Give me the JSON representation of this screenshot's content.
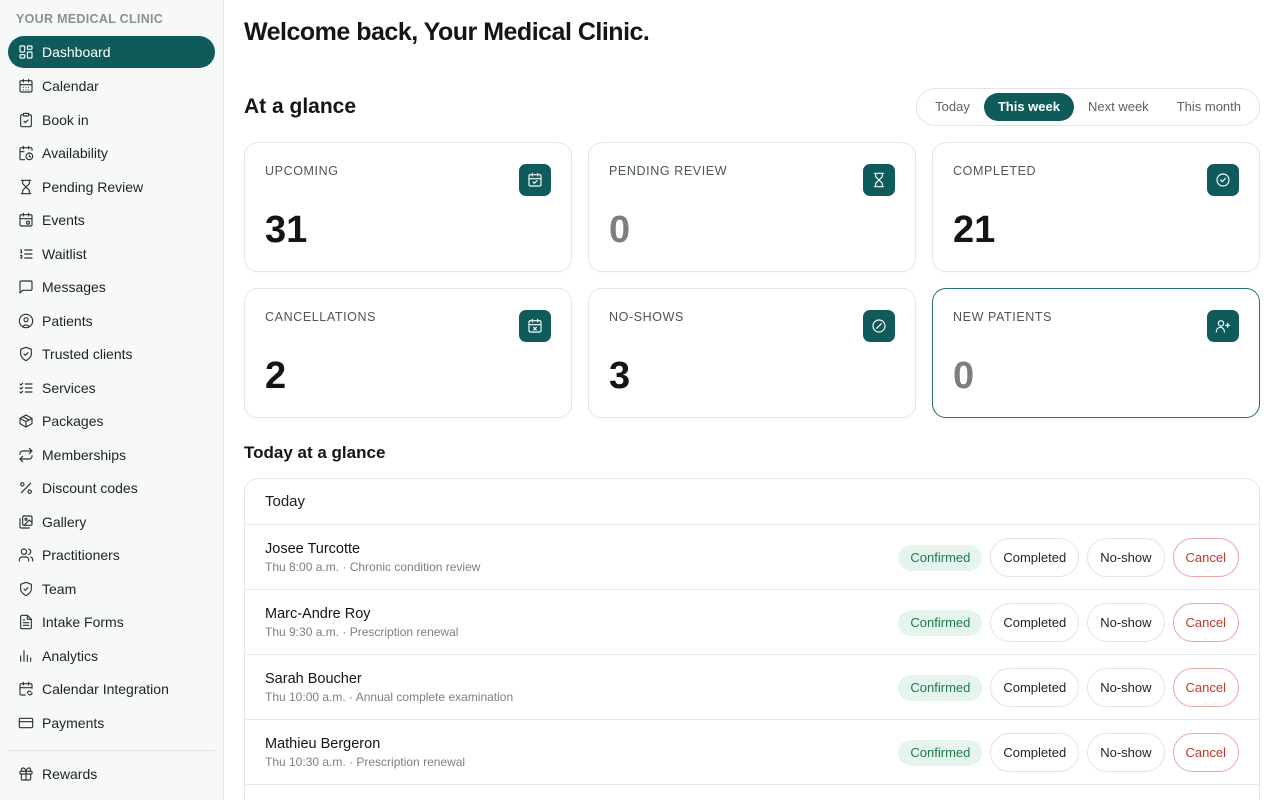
{
  "sidebar": {
    "org_name": "YOUR MEDICAL CLINIC",
    "items": [
      {
        "label": "Dashboard",
        "icon": "grid-icon",
        "active": true
      },
      {
        "label": "Calendar",
        "icon": "calendar-icon"
      },
      {
        "label": "Book in",
        "icon": "clipboard-icon"
      },
      {
        "label": "Availability",
        "icon": "calendar-clock-icon"
      },
      {
        "label": "Pending Review",
        "icon": "hourglass-icon"
      },
      {
        "label": "Events",
        "icon": "calendar-event-icon"
      },
      {
        "label": "Waitlist",
        "icon": "list-ordered-icon"
      },
      {
        "label": "Messages",
        "icon": "message-icon"
      },
      {
        "label": "Patients",
        "icon": "user-circle-icon"
      },
      {
        "label": "Trusted clients",
        "icon": "shield-check-icon"
      },
      {
        "label": "Services",
        "icon": "list-check-icon"
      },
      {
        "label": "Packages",
        "icon": "package-icon"
      },
      {
        "label": "Memberships",
        "icon": "repeat-icon"
      },
      {
        "label": "Discount codes",
        "icon": "percent-icon"
      },
      {
        "label": "Gallery",
        "icon": "images-icon"
      },
      {
        "label": "Practitioners",
        "icon": "users-icon"
      },
      {
        "label": "Team",
        "icon": "shield-icon"
      },
      {
        "label": "Intake Forms",
        "icon": "file-text-icon"
      },
      {
        "label": "Analytics",
        "icon": "bar-chart-icon"
      },
      {
        "label": "Calendar Integration",
        "icon": "calendar-sync-icon"
      },
      {
        "label": "Payments",
        "icon": "credit-card-icon"
      }
    ],
    "footer_items": [
      {
        "label": "Rewards",
        "icon": "gift-icon"
      }
    ]
  },
  "header": {
    "welcome": "Welcome back, Your Medical Clinic."
  },
  "glance": {
    "title": "At a glance",
    "periods": [
      "Today",
      "This week",
      "Next week",
      "This month"
    ],
    "selected_period": "This week",
    "cards": [
      {
        "label": "UPCOMING",
        "value": "31",
        "icon": "calendar-check-icon"
      },
      {
        "label": "PENDING REVIEW",
        "value": "0",
        "icon": "hourglass-icon"
      },
      {
        "label": "COMPLETED",
        "value": "21",
        "icon": "check-circle-icon"
      },
      {
        "label": "CANCELLATIONS",
        "value": "2",
        "icon": "calendar-x-icon"
      },
      {
        "label": "NO-SHOWS",
        "value": "3",
        "icon": "ban-icon"
      },
      {
        "label": "NEW PATIENTS",
        "value": "0",
        "icon": "user-plus-icon"
      }
    ]
  },
  "today": {
    "title": "Today at a glance",
    "table_header": "Today",
    "status_label": "Confirmed",
    "completed_label": "Completed",
    "noshow_label": "No-show",
    "cancel_label": "Cancel",
    "rows": [
      {
        "name": "Josee Turcotte",
        "detail": "Thu 8:00 a.m. · Chronic condition review"
      },
      {
        "name": "Marc-Andre Roy",
        "detail": "Thu 9:30 a.m. · Prescription renewal"
      },
      {
        "name": "Sarah Boucher",
        "detail": "Thu 10:00 a.m. · Annual complete examination"
      },
      {
        "name": "Mathieu Bergeron",
        "detail": "Thu 10:30 a.m. · Prescription renewal"
      }
    ]
  },
  "colors": {
    "accent": "#0f5b5b",
    "confirmed_bg": "#e5f4ec",
    "confirmed_text": "#1f7a4d",
    "cancel": "#c0392b"
  }
}
